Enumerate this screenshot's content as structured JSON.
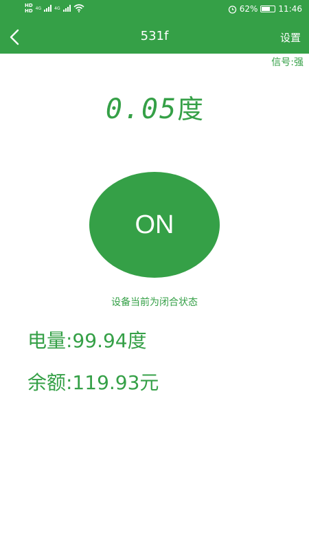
{
  "status_bar": {
    "hd1": "HD",
    "hd2": "HD",
    "net1": "4G",
    "net2": "4G",
    "battery_percent": "62%",
    "battery_level": 62,
    "time": "11:46",
    "icons": [
      "alarm-icon",
      "wifi-icon",
      "signal-icon",
      "battery-icon"
    ]
  },
  "header": {
    "title": "531f",
    "settings_label": "设置"
  },
  "signal": {
    "label": "信号:强"
  },
  "meter": {
    "value": "0.05",
    "unit": "度"
  },
  "power_button": {
    "label": "ON"
  },
  "device_state": "设备当前为闭合状态",
  "energy": {
    "text": "电量:99.94度"
  },
  "balance": {
    "text": "余额:119.93元"
  },
  "colors": {
    "brand": "#35a047",
    "background": "#ffffff"
  }
}
